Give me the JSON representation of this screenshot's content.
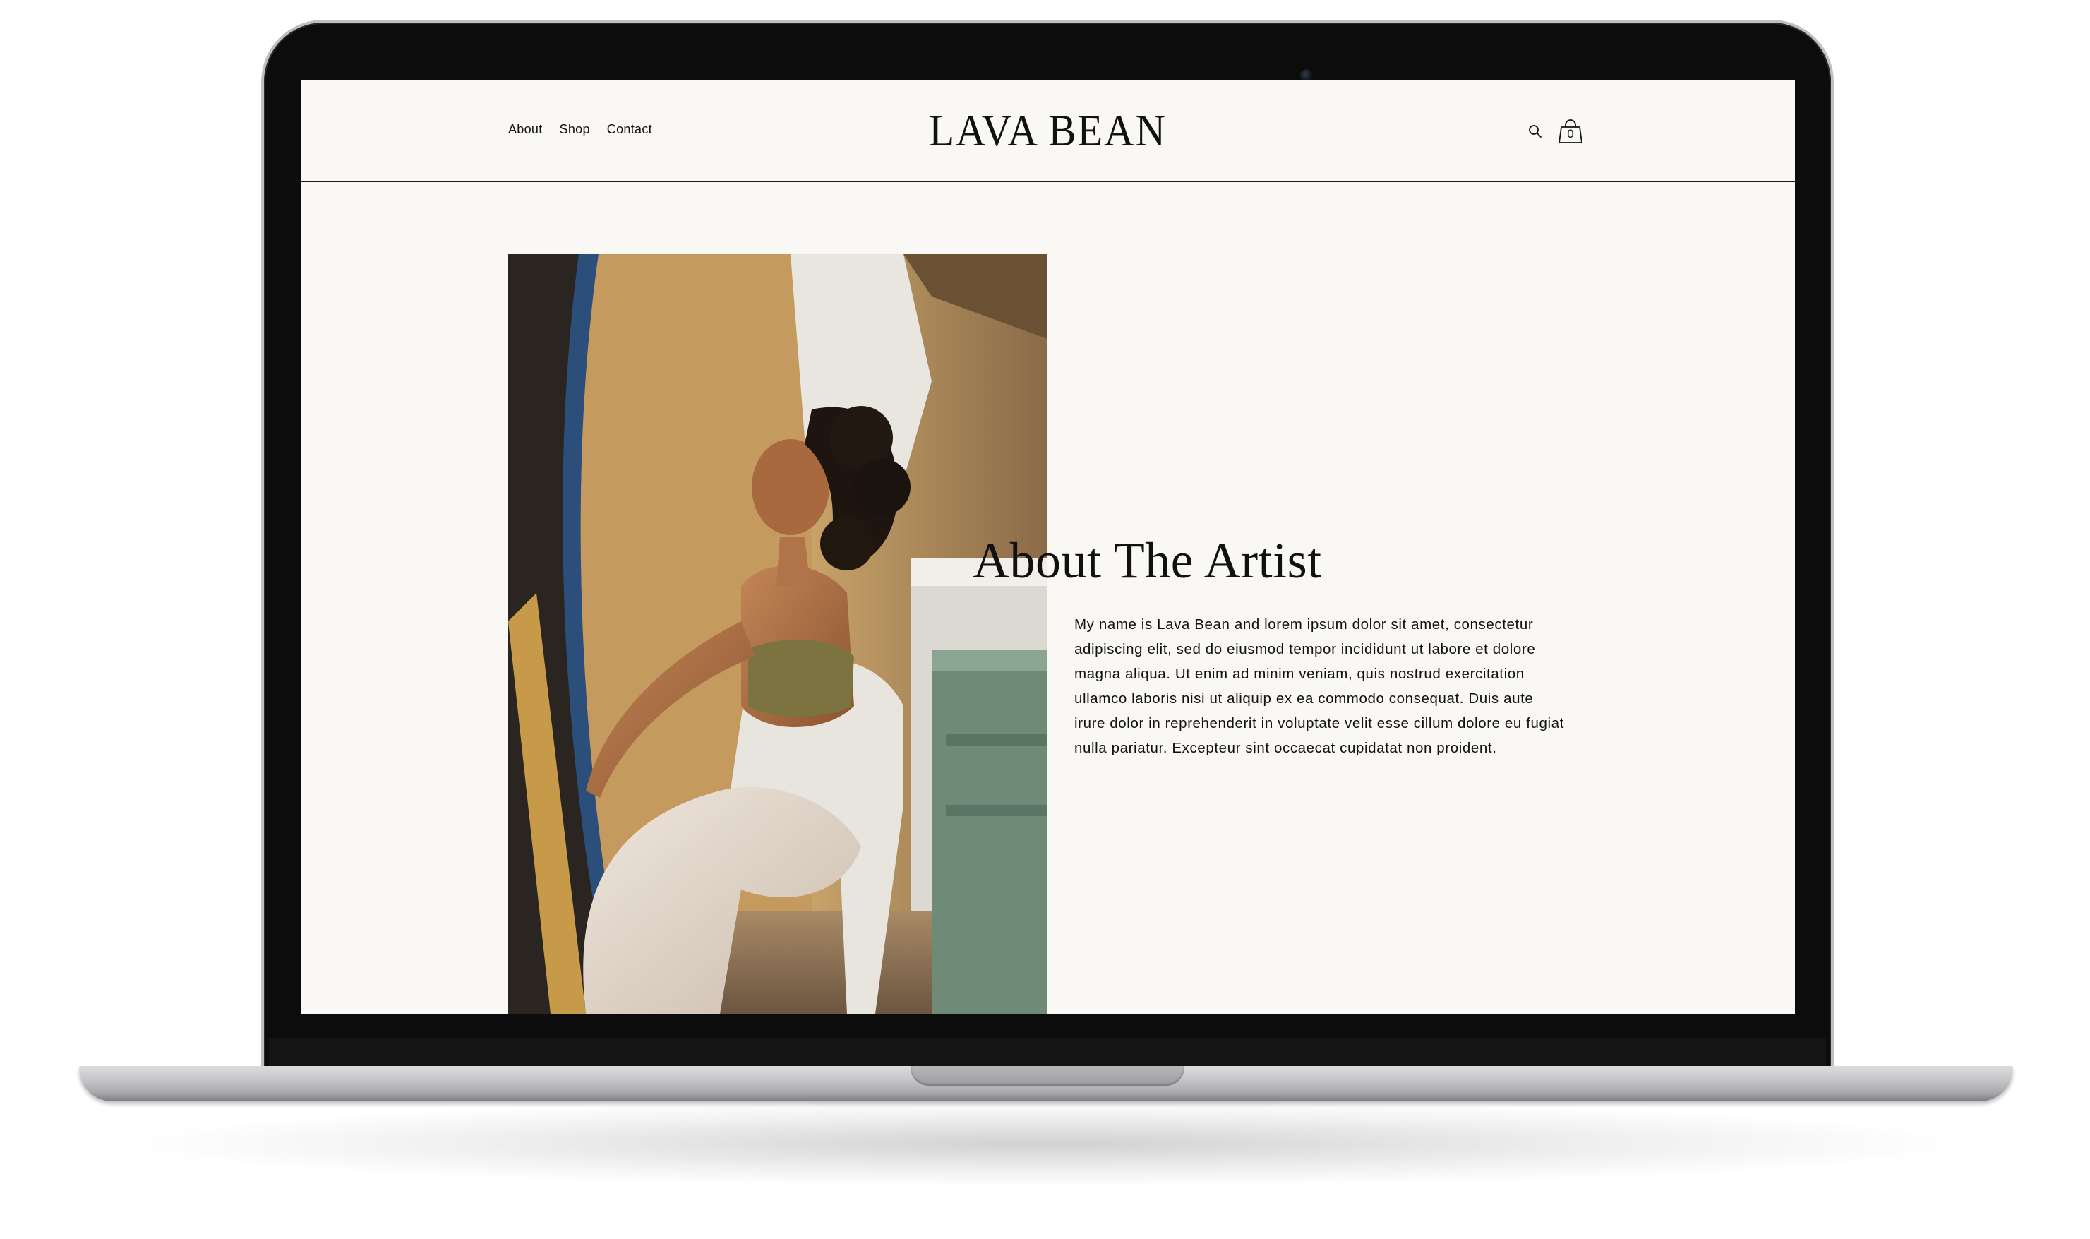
{
  "header": {
    "nav": [
      "About",
      "Shop",
      "Contact"
    ],
    "logo": "LAVA BEAN",
    "cart_count": "0",
    "icons": [
      "search-icon",
      "shopping-bag-icon"
    ]
  },
  "hero": {
    "image_alt": "Woman seated in a white plastic chair in sunlight",
    "heading": "About The Artist",
    "body": "My name is Lava Bean and lorem ipsum dolor sit amet, consectetur adipiscing elit, sed do eiusmod tempor incididunt ut labore et dolore magna aliqua. Ut enim ad minim veniam, quis nostrud exercitation ullamco laboris nisi ut aliquip ex ea commodo consequat. Duis aute irure dolor in reprehenderit in voluptate velit esse cillum dolore eu fugiat nulla pariatur. Excepteur sint occaecat cupidatat non proident."
  },
  "colors": {
    "page_background": "#faf8f4",
    "text": "#111111",
    "device_bezel": "#0c0c0c",
    "device_aluminum": "#c9c9cc"
  }
}
